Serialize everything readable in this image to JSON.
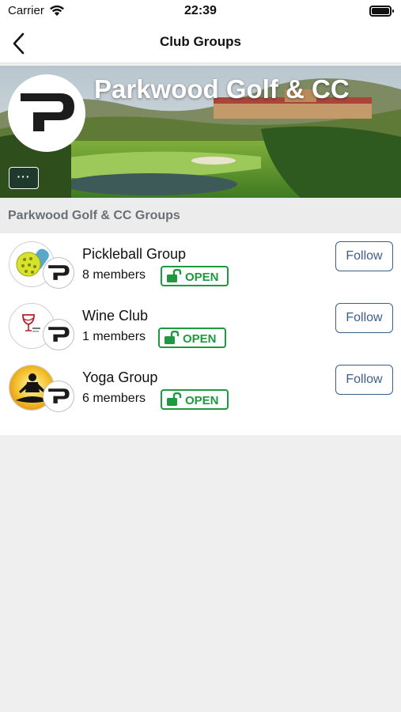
{
  "status_bar": {
    "carrier": "Carrier",
    "time": "22:39"
  },
  "nav": {
    "title": "Club Groups"
  },
  "hero": {
    "club_name": "Parkwood Golf & CC",
    "more_label": "···"
  },
  "section": {
    "title": "Parkwood Golf & CC Groups"
  },
  "groups": [
    {
      "name": "Pickleball Group",
      "members": "8 members",
      "status": "OPEN",
      "follow_label": "Follow"
    },
    {
      "name": "Wine Club",
      "members": "1 members",
      "status": "OPEN",
      "follow_label": "Follow"
    },
    {
      "name": "Yoga Group",
      "members": "6 members",
      "status": "OPEN",
      "follow_label": "Follow"
    }
  ],
  "colors": {
    "open_green": "#1d9a3f",
    "follow_blue": "#3d5e86"
  }
}
